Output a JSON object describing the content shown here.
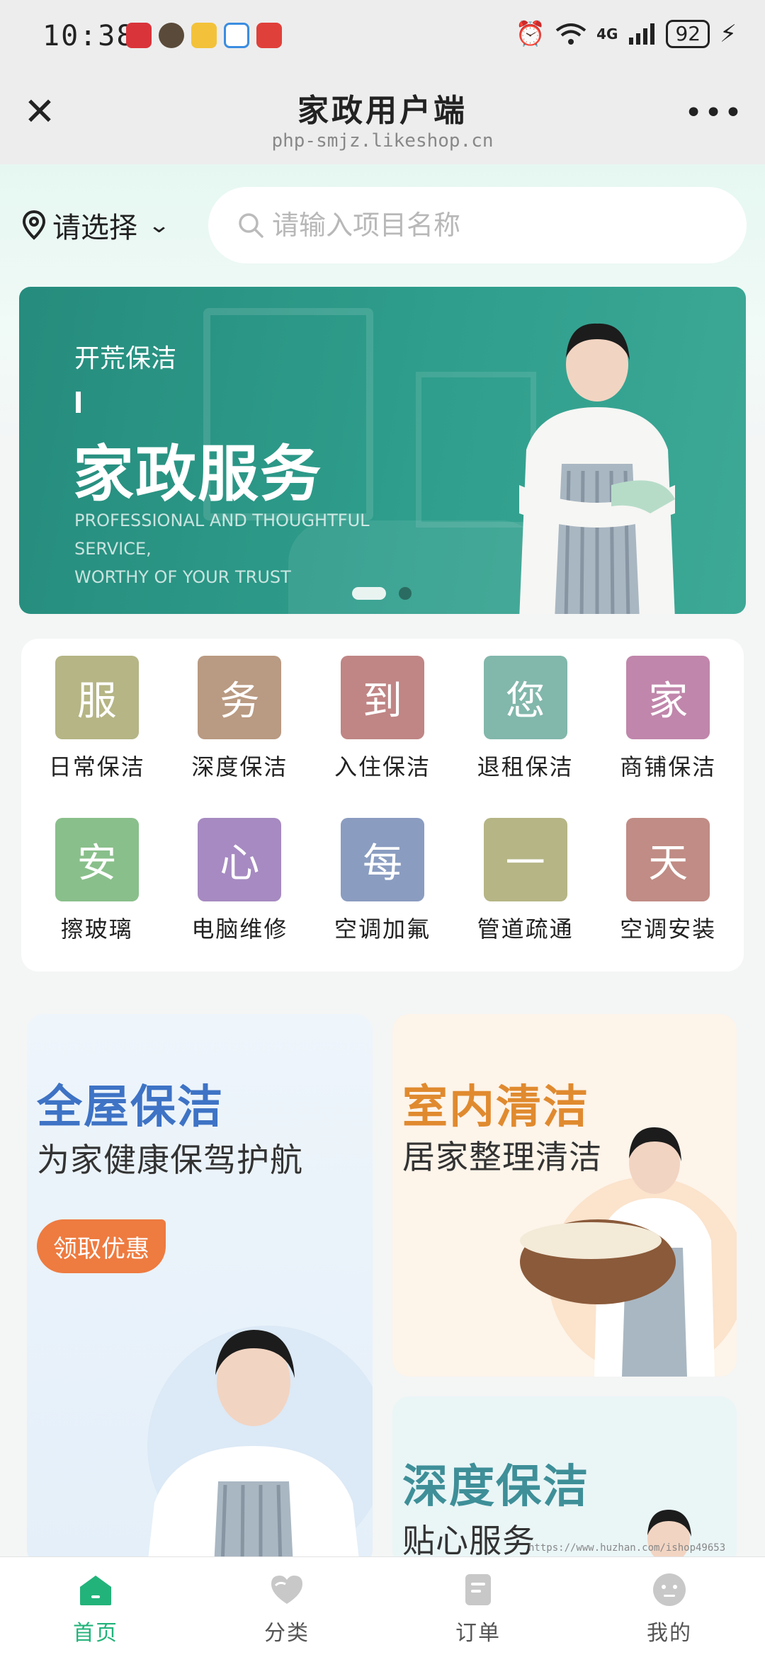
{
  "status_bar": {
    "time": "10:38",
    "network": "4G",
    "battery": "92",
    "app_icons": [
      "huawei-app-icon",
      "avatar-app-icon",
      "weibo-app-icon",
      "chat-app-icon",
      "game-app-icon"
    ]
  },
  "header": {
    "title": "家政用户端",
    "domain": "php-smjz.likeshop.cn"
  },
  "location": {
    "label": "请选择"
  },
  "search": {
    "placeholder": "请输入项目名称"
  },
  "banner": {
    "small_text": "开荒保洁",
    "big_text": "家政服务",
    "en_line1": "PROFESSIONAL AND THOUGHTFUL SERVICE,",
    "en_line2": "WORTHY OF YOUR TRUST",
    "slide_count": 2,
    "active_slide": 1
  },
  "categories": [
    {
      "char": "服",
      "label": "日常保洁",
      "color": "#b5b585"
    },
    {
      "char": "务",
      "label": "深度保洁",
      "color": "#b99a82"
    },
    {
      "char": "到",
      "label": "入住保洁",
      "color": "#c08585"
    },
    {
      "char": "您",
      "label": "退租保洁",
      "color": "#82b7ab"
    },
    {
      "char": "家",
      "label": "商铺保洁",
      "color": "#c086ab"
    },
    {
      "char": "安",
      "label": "擦玻璃",
      "color": "#89bf8b"
    },
    {
      "char": "心",
      "label": "电脑维修",
      "color": "#a68ac1"
    },
    {
      "char": "每",
      "label": "空调加氟",
      "color": "#8a9cc0"
    },
    {
      "char": "一",
      "label": "管道疏通",
      "color": "#b5b585"
    },
    {
      "char": "天",
      "label": "空调安装",
      "color": "#c08c85"
    }
  ],
  "promos": {
    "left": {
      "title": "全屋保洁",
      "subtitle": "为家健康保驾护航",
      "button": "领取优惠"
    },
    "top_right": {
      "title": "室内清洁",
      "subtitle": "居家整理清洁"
    },
    "bottom_right": {
      "title": "深度保洁",
      "subtitle": "贴心服务"
    }
  },
  "watermark": "https://www.huzhan.com/ishop49653",
  "tabs": [
    {
      "label": "首页",
      "icon": "home-icon",
      "active": true
    },
    {
      "label": "分类",
      "icon": "category-heart-icon",
      "active": false
    },
    {
      "label": "订单",
      "icon": "order-doc-icon",
      "active": false
    },
    {
      "label": "我的",
      "icon": "profile-face-icon",
      "active": false
    }
  ],
  "colors": {
    "accent": "#22b37a",
    "tab_inactive": "#c8c8c8",
    "coupon": "#ee7b40"
  }
}
